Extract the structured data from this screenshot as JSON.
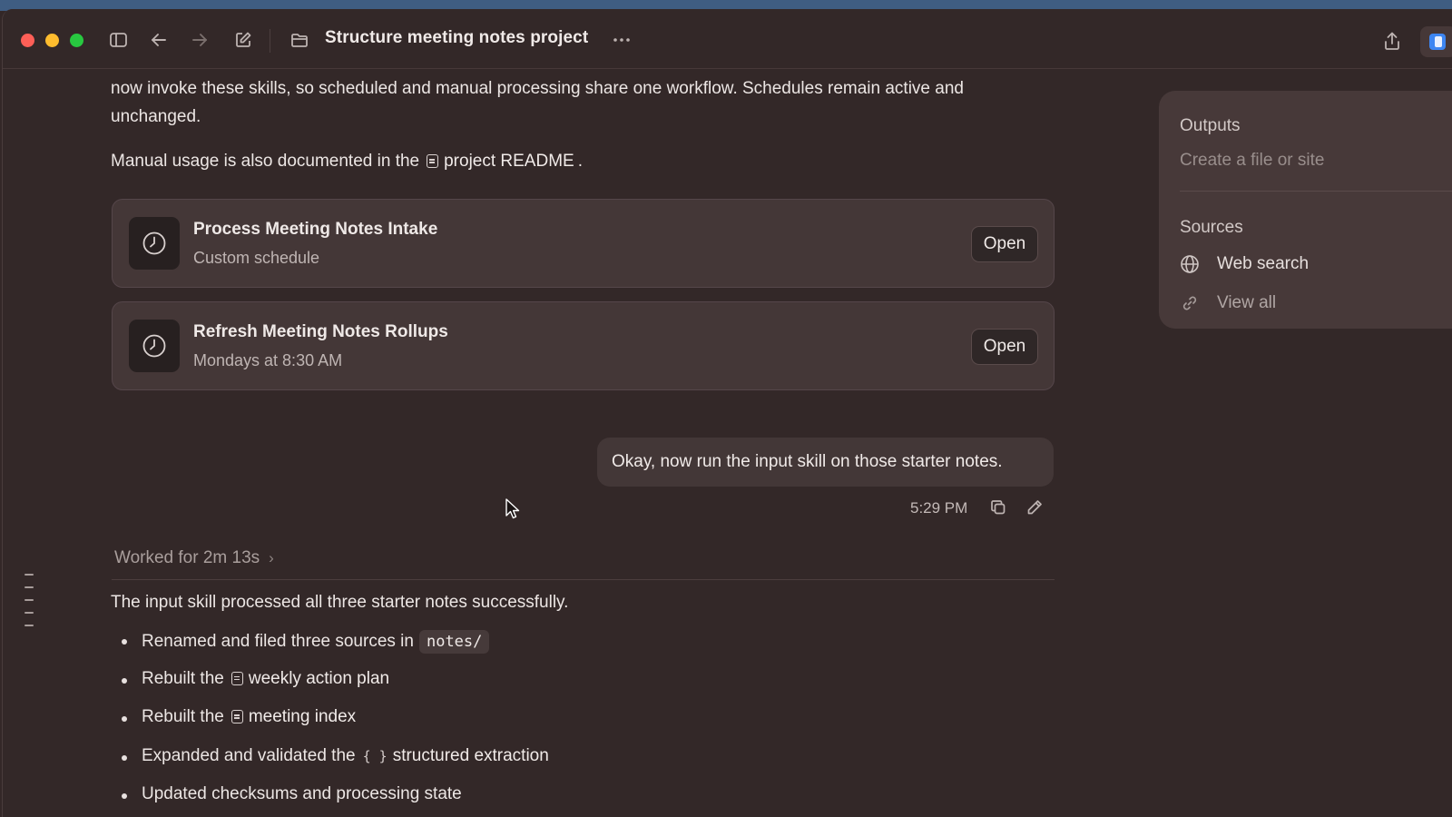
{
  "window": {
    "title": "Structure meeting notes project"
  },
  "conversation": {
    "intro_text": "now invoke these skills, so scheduled and manual processing share one workflow. Schedules remain active and unchanged.",
    "manual_usage_prefix": "Manual usage is also documented in the",
    "readme_link": "project README",
    "manual_usage_suffix": ".",
    "schedules": [
      {
        "title": "Process Meeting Notes Intake",
        "subtitle": "Custom schedule",
        "button": "Open"
      },
      {
        "title": "Refresh Meeting Notes Rollups",
        "subtitle": "Mondays at 8:30 AM",
        "button": "Open"
      }
    ],
    "user_message": {
      "text": "Okay, now run the input skill on those starter notes.",
      "time": "5:29 PM"
    },
    "worked_for": "Worked for 2m 13s",
    "response_intro": "The input skill processed all three starter notes successfully.",
    "bullets": [
      {
        "text": "Renamed and filed three sources in",
        "code": "notes/"
      },
      {
        "prefix": "Rebuilt the",
        "link": "weekly action plan"
      },
      {
        "prefix": "Rebuilt the",
        "link": "meeting index"
      },
      {
        "prefix": "Expanded and validated the",
        "link": "structured extraction"
      },
      {
        "text": "Updated checksums and processing state"
      }
    ]
  },
  "side_panel": {
    "outputs_heading": "Outputs",
    "outputs_placeholder": "Create a file or site",
    "sources_heading": "Sources",
    "sources": [
      {
        "label": "Web search",
        "icon": "globe-icon"
      },
      {
        "label": "View all",
        "icon": "link-icon"
      }
    ]
  },
  "colors": {
    "background": "#332828",
    "card": "#443737",
    "accent": "#3d86f2"
  }
}
